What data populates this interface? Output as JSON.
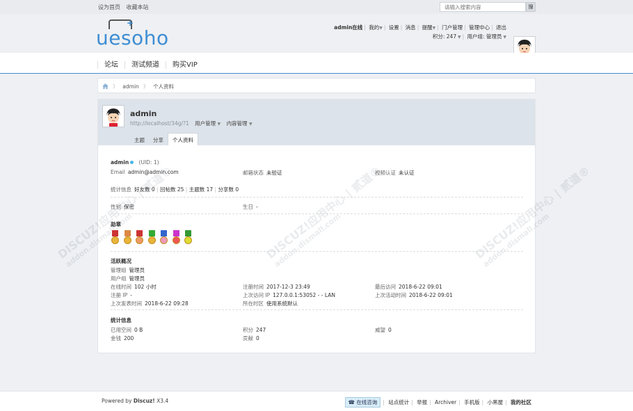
{
  "topbar": {
    "set_home": "设为首页",
    "bookmark": "收藏本站",
    "search_placeholder": "请输入搜索内容",
    "search_button": "搜"
  },
  "logo": {
    "text": "uesoho"
  },
  "user_menu": {
    "line1": [
      "admin在线",
      "我的",
      "设置",
      "消息",
      "提醒",
      "门户管理",
      "管理中心",
      "退出"
    ],
    "points": "积分: 247",
    "group": "用户组: 管理员"
  },
  "nav": {
    "items": [
      "论坛",
      "测试频道",
      "购买VIP"
    ]
  },
  "breadcrumb": {
    "items": [
      "admin",
      "个人资料"
    ]
  },
  "profile": {
    "name": "admin",
    "url": "http://localhost/34g/?1",
    "menus": [
      "用户管理",
      "内容管理"
    ],
    "tabs": [
      "主题",
      "分享",
      "个人资料"
    ],
    "active_tab": "个人资料",
    "uid": "(UID: 1)",
    "email_label": "Email",
    "email": "admin@admin.com",
    "email_status_label": "邮箱状态",
    "email_status": "未验证",
    "video_label": "视频认证",
    "video_status": "未认证",
    "stats_line": {
      "label": "统计信息",
      "friends": "好友数 0",
      "replies": "回帖数 25",
      "threads": "主题数 17",
      "shares": "分享数 0"
    },
    "gender_label": "性别",
    "gender": "保密",
    "birthday_label": "生日",
    "birthday": "-",
    "medals_title": "勋章",
    "activity_title": "活跃概况",
    "admin_group_label": "管理组",
    "admin_group": "管理员",
    "user_group_label": "用户组",
    "user_group": "管理员",
    "online_time_label": "在线时间",
    "online_time": "102 小时",
    "reg_time_label": "注册时间",
    "reg_time": "2017-12-3 23:49",
    "last_visit_label": "最后访问",
    "last_visit": "2018-6-22 09:01",
    "reg_ip_label": "注册 IP",
    "reg_ip": "-",
    "last_ip_label": "上次访问 IP",
    "last_ip": "127.0.0.1:53052 - - LAN",
    "last_active_label": "上次活动时间",
    "last_active": "2018-6-22 09:01",
    "last_post_label": "上次发表时间",
    "last_post": "2018-6-22 09:28",
    "timezone_label": "所在时区",
    "timezone": "使用系统默认",
    "stats_title": "统计信息",
    "space_label": "已用空间",
    "space": "0 B",
    "credits_label": "积分",
    "credits": "247",
    "prestige_label": "威望",
    "prestige": "0",
    "money_label": "金钱",
    "money": "200",
    "contrib_label": "贡献",
    "contrib": "0"
  },
  "watermark": {
    "line1": "DISCUZ!应用中心 | 贰道®",
    "line2": "addon.dismall.com"
  },
  "footer": {
    "powered": "Powered by",
    "brand": "Discuz!",
    "version": "X3.4",
    "chat": "在线咨询",
    "links": [
      "站点统计",
      "举报",
      "Archiver",
      "手机版",
      "小黑屋",
      "我的社区"
    ]
  }
}
